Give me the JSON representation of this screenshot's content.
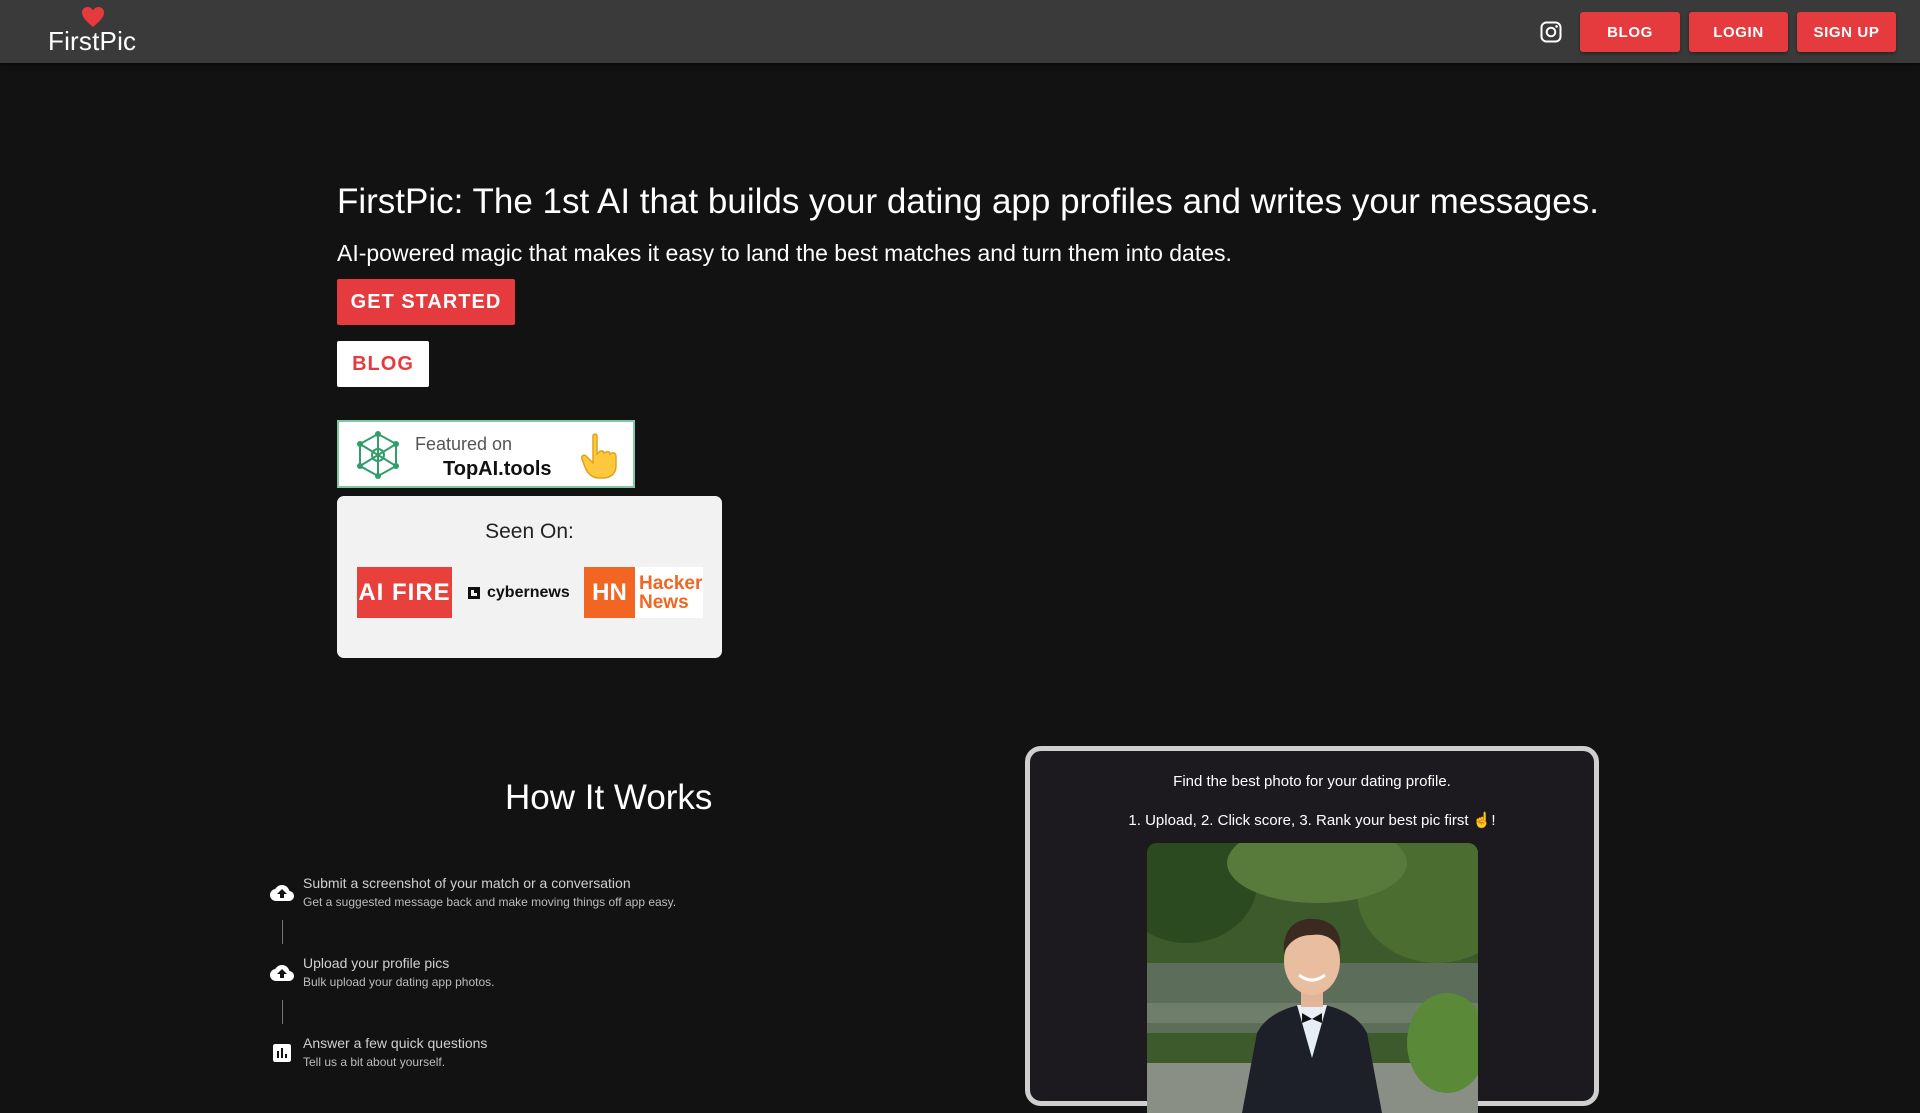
{
  "header": {
    "brand": "FirstPic",
    "nav": {
      "blog": "BLOG",
      "login": "LOGIN",
      "signup": "SIGN UP"
    },
    "icons": {
      "logo": "heart-icon",
      "social": "instagram-icon"
    }
  },
  "hero": {
    "title": "FirstPic: The 1st AI that builds your dating app profiles and writes your messages.",
    "subtitle": "AI-powered magic that makes it easy to land the best matches and turn them into dates.",
    "get_started": "GET STARTED",
    "blog": "BLOG"
  },
  "featured": {
    "line1": "Featured on",
    "line2": "TopAI.tools",
    "icons": [
      "network-icon",
      "pointing-hand-icon"
    ]
  },
  "seen_on": {
    "title": "Seen On:",
    "logos": {
      "aifire": "AI FIRE",
      "cybernews": "cybernews",
      "hn_badge": "HN",
      "hn_line1": "Hacker",
      "hn_line2": "News"
    }
  },
  "how_it_works": {
    "title": "How It Works",
    "steps": [
      {
        "icon": "cloud-upload-icon",
        "title": "Submit a screenshot of your match or a conversation",
        "desc": "Get a suggested message back and make moving things off app easy."
      },
      {
        "icon": "cloud-upload-icon",
        "title": "Upload your profile pics",
        "desc": "Bulk upload your dating app photos."
      },
      {
        "icon": "bar-chart-icon",
        "title": "Answer a few quick questions",
        "desc": "Tell us a bit about yourself."
      }
    ]
  },
  "demo": {
    "line1": "Find the best photo for your dating profile.",
    "line2": "1. Upload, 2. Click score, 3. Rank your best pic first ☝️!",
    "photo": "profile-photo-man-in-tuxedo"
  },
  "colors": {
    "accent": "#e63b3e",
    "background": "#121212",
    "topbar": "#3a3a3a",
    "hn_orange": "#f26522"
  }
}
